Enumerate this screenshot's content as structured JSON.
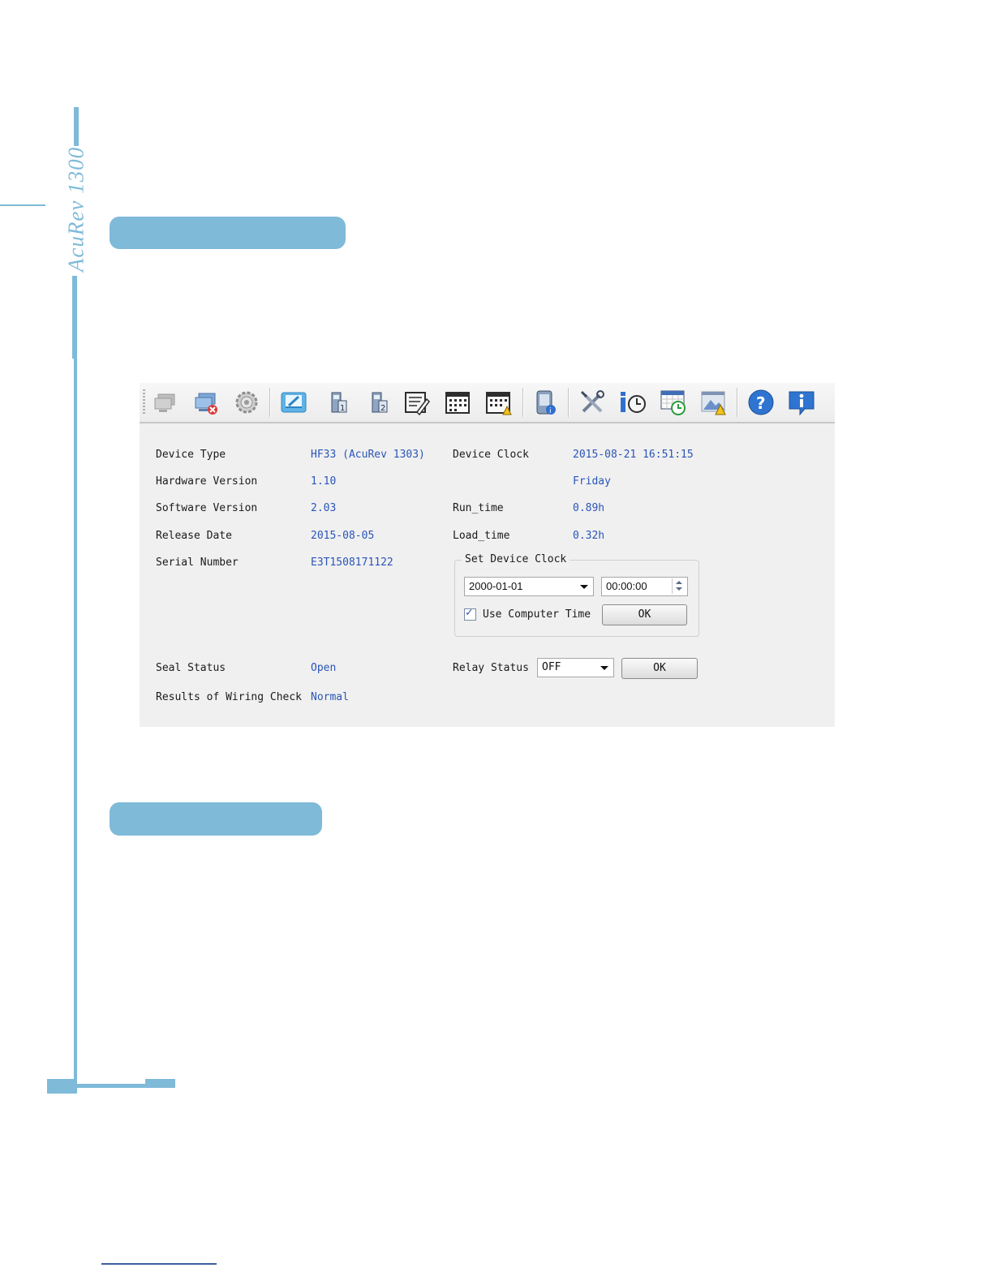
{
  "sidebar": {
    "brand": "AcuRev 1300"
  },
  "toolbar": {
    "icons": [
      "connect-icon",
      "disconnect-icon",
      "settings-icon",
      "edit-icon",
      "meter-1-icon",
      "meter-2-icon",
      "report-icon",
      "calendar-icon",
      "calendar-alert-icon",
      "device-info-icon",
      "tools-icon",
      "time-info-icon",
      "schedule-icon",
      "warning-image-icon",
      "help-icon",
      "info-icon"
    ]
  },
  "device_info": {
    "device_type_label": "Device Type",
    "device_type_value": "HF33 (AcuRev 1303)",
    "hardware_version_label": "Hardware Version",
    "hardware_version_value": "1.10",
    "software_version_label": "Software Version",
    "software_version_value": "2.03",
    "release_date_label": "Release Date",
    "release_date_value": "2015-08-05",
    "serial_number_label": "Serial Number",
    "serial_number_value": "E3T1508171122",
    "device_clock_label": "Device Clock",
    "device_clock_value": "2015-08-21 16:51:15",
    "day_value": "Friday",
    "run_time_label": "Run_time",
    "run_time_value": "0.89h",
    "load_time_label": "Load_time",
    "load_time_value": "0.32h",
    "seal_status_label": "Seal Status",
    "seal_status_value": "Open",
    "wiring_check_label": "Results of Wiring Check",
    "wiring_check_value": "Normal"
  },
  "set_clock": {
    "title": "Set Device Clock",
    "date_value": "2000-01-01",
    "time_value": "00:00:00",
    "use_computer_time_label": "Use Computer Time",
    "use_computer_time_checked": true,
    "ok_label": "OK"
  },
  "relay": {
    "label": "Relay Status",
    "value": "OFF",
    "ok_label": "OK"
  },
  "colors": {
    "accent": "#7fbad8",
    "value_text": "#2a55b8",
    "window_bg": "#f0f0f0"
  }
}
